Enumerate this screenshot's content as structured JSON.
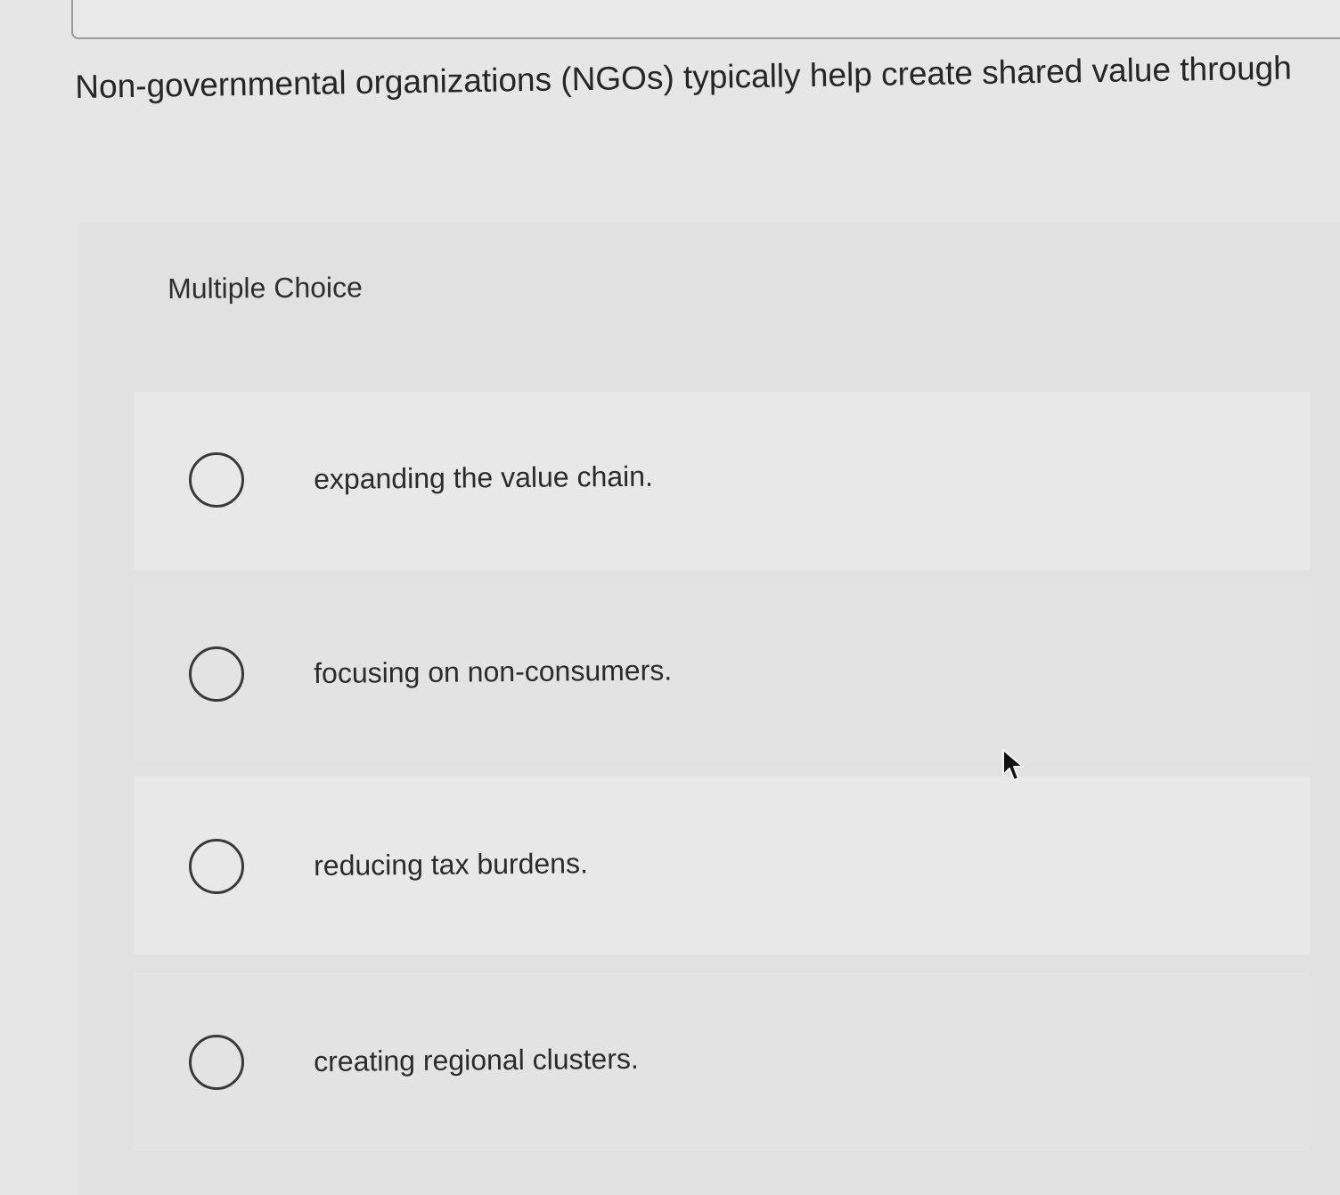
{
  "question": {
    "text": "Non-governmental organizations (NGOs) typically help create shared value through"
  },
  "section": {
    "label": "Multiple Choice"
  },
  "options": [
    {
      "label": "expanding the value chain.",
      "selected": false
    },
    {
      "label": "focusing on non-consumers.",
      "selected": false
    },
    {
      "label": "reducing tax burdens.",
      "selected": false
    },
    {
      "label": "creating regional clusters.",
      "selected": false
    }
  ],
  "icons": {
    "radio": "radio-unselected-icon",
    "pointer": "mouse-pointer-icon"
  },
  "colors": {
    "background": "#e6e6e6",
    "panel": "#e1e1e1",
    "text": "#2b2b2b",
    "radio_border": "#3a3a3a"
  }
}
